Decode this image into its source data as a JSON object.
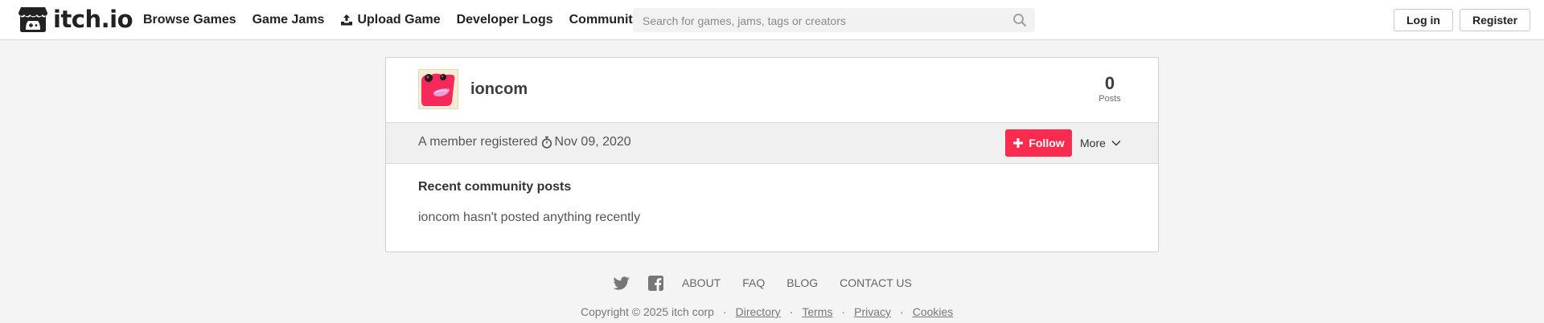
{
  "brand": {
    "name": "itch.io"
  },
  "nav": {
    "browse_games": "Browse Games",
    "game_jams": "Game Jams",
    "upload_game": "Upload Game",
    "developer_logs": "Developer Logs",
    "community": "Community"
  },
  "search": {
    "placeholder": "Search for games, jams, tags or creators",
    "value": ""
  },
  "header_buttons": {
    "login": "Log in",
    "register": "Register"
  },
  "profile": {
    "username": "ioncom",
    "posts_count": "0",
    "posts_label": "Posts",
    "registered_prefix": "A member registered",
    "registered_date": "Nov 09, 2020",
    "follow_label": "Follow",
    "more_label": "More",
    "recent_posts_title": "Recent community posts",
    "empty_message": "ioncom hasn't posted anything recently"
  },
  "footer": {
    "links": [
      "ABOUT",
      "FAQ",
      "BLOG",
      "CONTACT US"
    ],
    "copyright": "Copyright © 2025 itch corp",
    "legal_links": [
      "Directory",
      "Terms",
      "Privacy",
      "Cookies"
    ],
    "separator": "·"
  },
  "icons": {
    "logo": "itchio-logo-icon",
    "upload": "upload-game-icon",
    "search": "search-icon",
    "clock": "stopwatch-icon",
    "follow_plus": "plus-icon",
    "more_chevron": "chevron-down-icon",
    "twitter": "twitter-icon",
    "facebook": "facebook-icon"
  },
  "colors": {
    "accent": "#fa2b4f",
    "text": "#434343",
    "background": "#f4f4f4"
  }
}
